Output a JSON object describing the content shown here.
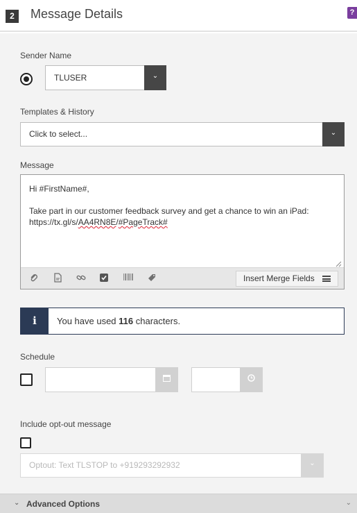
{
  "header": {
    "step": "2",
    "title": "Message Details",
    "help": "?"
  },
  "sender": {
    "label": "Sender Name",
    "value": "TLUSER",
    "caret": "⌄"
  },
  "templates": {
    "label": "Templates & History",
    "placeholder": "Click to select...",
    "caret": "⌄"
  },
  "message": {
    "label": "Message",
    "line1": "Hi #FirstName#,",
    "line2": "Take part in our customer feedback survey and get a chance to win an iPad:",
    "line3_prefix": "https://tx.gl/s/",
    "line3_code": "AA4RN8E",
    "line3_sep": "/",
    "line3_tag": "#PageTrack#",
    "toolbar": {
      "attach_icon": "paperclip-icon",
      "file_icon": "file-icon",
      "link_icon": "link-icon",
      "check_icon": "checkbox-icon",
      "barcode_icon": "barcode-icon",
      "tag_icon": "tag-icon",
      "merge_label": "Insert Merge Fields"
    }
  },
  "info": {
    "icon": "i",
    "prefix": "You have used ",
    "count": "116",
    "suffix": " characters."
  },
  "schedule": {
    "label": "Schedule"
  },
  "optout": {
    "label": "Include opt-out message",
    "placeholder": "Optout: Text TLSTOP to +919293292932",
    "caret": "⌄"
  },
  "advanced": {
    "title": "Advanced Options",
    "chevron": "⌄"
  }
}
